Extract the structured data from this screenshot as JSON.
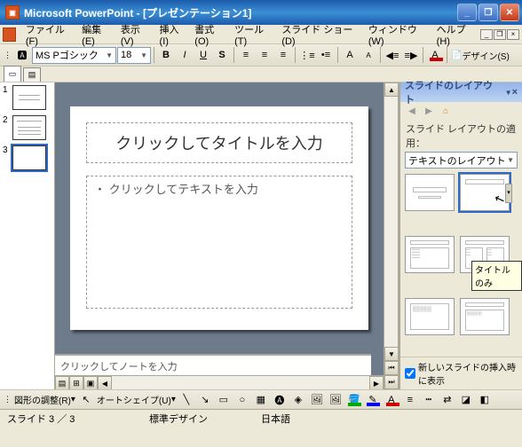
{
  "window": {
    "title": "Microsoft PowerPoint - [プレゼンテーション1]"
  },
  "menu": {
    "file": "ファイル(F)",
    "edit": "編集(E)",
    "view": "表示(V)",
    "insert": "挿入(I)",
    "format": "書式(O)",
    "tools": "ツール(T)",
    "slideshow": "スライド ショー(D)",
    "window": "ウィンドウ(W)",
    "help": "ヘルプ(H)"
  },
  "toolbar": {
    "font": "MS Pゴシック",
    "size": "18",
    "design_btn": "デザイン(S)"
  },
  "slide": {
    "title_placeholder": "クリックしてタイトルを入力",
    "body_placeholder": "・ クリックしてテキストを入力"
  },
  "notes": {
    "placeholder": "クリックしてノートを入力"
  },
  "taskpane": {
    "title": "スライドのレイアウト",
    "apply_label": "スライド レイアウトの適用：",
    "category": "テキストのレイアウト",
    "tooltip": "タイトルのみ",
    "checkbox": "新しいスライドの挿入時に表示"
  },
  "drawbar": {
    "shapes_menu": "図形の調整(R)",
    "autoshape": "オートシェイプ(U)"
  },
  "status": {
    "slide": "スライド 3 ／ 3",
    "design": "標準デザイン",
    "lang": "日本語"
  }
}
